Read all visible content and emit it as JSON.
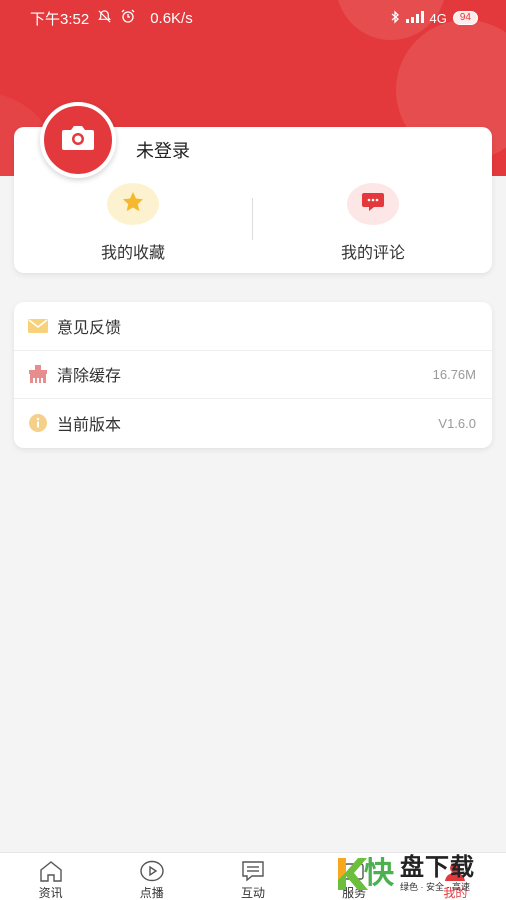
{
  "status_bar": {
    "time": "下午3:52",
    "speed": "0.6K/s",
    "network": "4G",
    "battery": "94"
  },
  "profile": {
    "login_status": "未登录",
    "shortcuts": [
      {
        "label": "我的收藏",
        "icon": "star-icon"
      },
      {
        "label": "我的评论",
        "icon": "comment-icon"
      }
    ]
  },
  "menu": [
    {
      "label": "意见反馈",
      "value": "",
      "icon": "envelope-icon"
    },
    {
      "label": "清除缓存",
      "value": "16.76M",
      "icon": "broom-icon"
    },
    {
      "label": "当前版本",
      "value": "V1.6.0",
      "icon": "info-icon"
    }
  ],
  "tabbar": [
    {
      "label": "资讯",
      "icon": "home-icon"
    },
    {
      "label": "点播",
      "icon": "play-icon"
    },
    {
      "label": "互动",
      "icon": "chat-icon"
    },
    {
      "label": "服务",
      "icon": "service-icon"
    },
    {
      "label": "我的",
      "icon": "profile-icon"
    }
  ],
  "watermark": {
    "brand": "快",
    "title": "盘下载",
    "subtitle": "绿色 · 安全 · 高速"
  },
  "colors": {
    "primary": "#e4393c",
    "star": "#f5b82e",
    "envelope": "#f7d27a",
    "broom": "#e88d8d",
    "info": "#f5d08a"
  }
}
